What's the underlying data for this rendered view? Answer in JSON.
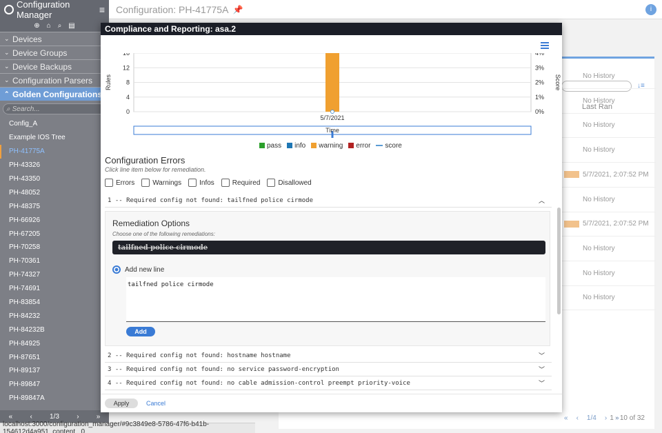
{
  "sidebar": {
    "app_title": "Configuration Manager",
    "sections": [
      {
        "label": "Devices"
      },
      {
        "label": "Device Groups"
      },
      {
        "label": "Device Backups"
      },
      {
        "label": "Configuration Parsers"
      },
      {
        "label": "Golden Configurations"
      }
    ],
    "search_placeholder": "Search...",
    "items": [
      "Config_A",
      "Example IOS Tree",
      "PH-41775A",
      "PH-43326",
      "PH-43350",
      "PH-48052",
      "PH-48375",
      "PH-66926",
      "PH-67205",
      "PH-70258",
      "PH-70361",
      "PH-74327",
      "PH-74691",
      "PH-83854",
      "PH-84232",
      "PH-84232B",
      "PH-84925",
      "PH-87651",
      "PH-89137",
      "PH-89847",
      "PH-89847A"
    ],
    "pager": "1/3"
  },
  "status_url": "localhost:3000/configuration_manager/#9c3849e8-5786-47f6-b41b-154612d4a951_content_ 0",
  "header": {
    "title": "Configuration: PH-41775A"
  },
  "background": {
    "last_ran_header": "Last Ran",
    "rows": [
      "No History",
      "No History",
      "No History",
      "No History",
      "5/7/2021, 2:07:52 PM",
      "No History",
      "5/7/2021, 2:07:52 PM",
      "No History",
      "No History",
      "No History"
    ],
    "pager": "1/4",
    "count": "1 - 10 of 32"
  },
  "modal": {
    "title": "Compliance and Reporting: asa.2",
    "chart_data": {
      "type": "bar",
      "categories": [
        "5/7/2021"
      ],
      "series": [
        {
          "name": "pass",
          "values": [
            0
          ],
          "color": "#2ca02c"
        },
        {
          "name": "info",
          "values": [
            0
          ],
          "color": "#1f77b4"
        },
        {
          "name": "warning",
          "values": [
            16
          ],
          "color": "#f0a030"
        },
        {
          "name": "error",
          "values": [
            0
          ],
          "color": "#b22222"
        },
        {
          "name": "score",
          "values": [
            0
          ],
          "color": "#5a9bd5"
        }
      ],
      "xlabel": "Time",
      "ylabel": "Rules",
      "y2label": "Score",
      "ylim": [
        0,
        16
      ],
      "y_ticks": [
        "0",
        "4",
        "8",
        "12",
        "16"
      ],
      "y2_ticks": [
        "0%",
        "1%",
        "2%",
        "3%",
        "4%"
      ],
      "legend": "bottom"
    },
    "errors_title": "Configuration Errors",
    "errors_subtitle": "Click line item below for remediation.",
    "filters": [
      "Errors",
      "Warnings",
      "Infos",
      "Required",
      "Disallowed"
    ],
    "errors": [
      "1 -- Required config not found: tailfned police cirmode",
      "2 -- Required config not found: hostname hostname",
      "3 -- Required config not found: no service password-encryption",
      "4 -- Required config not found: no cable admission-control preempt priority-voice"
    ],
    "remediation": {
      "title": "Remediation Options",
      "subtitle": "Choose one of the following remediations:",
      "option": "tailfned police cirmode",
      "radio_label": "Add new line",
      "textarea_value": "tailfned police cirmode",
      "add_label": "Add"
    },
    "apply_label": "Apply",
    "cancel_label": "Cancel"
  }
}
